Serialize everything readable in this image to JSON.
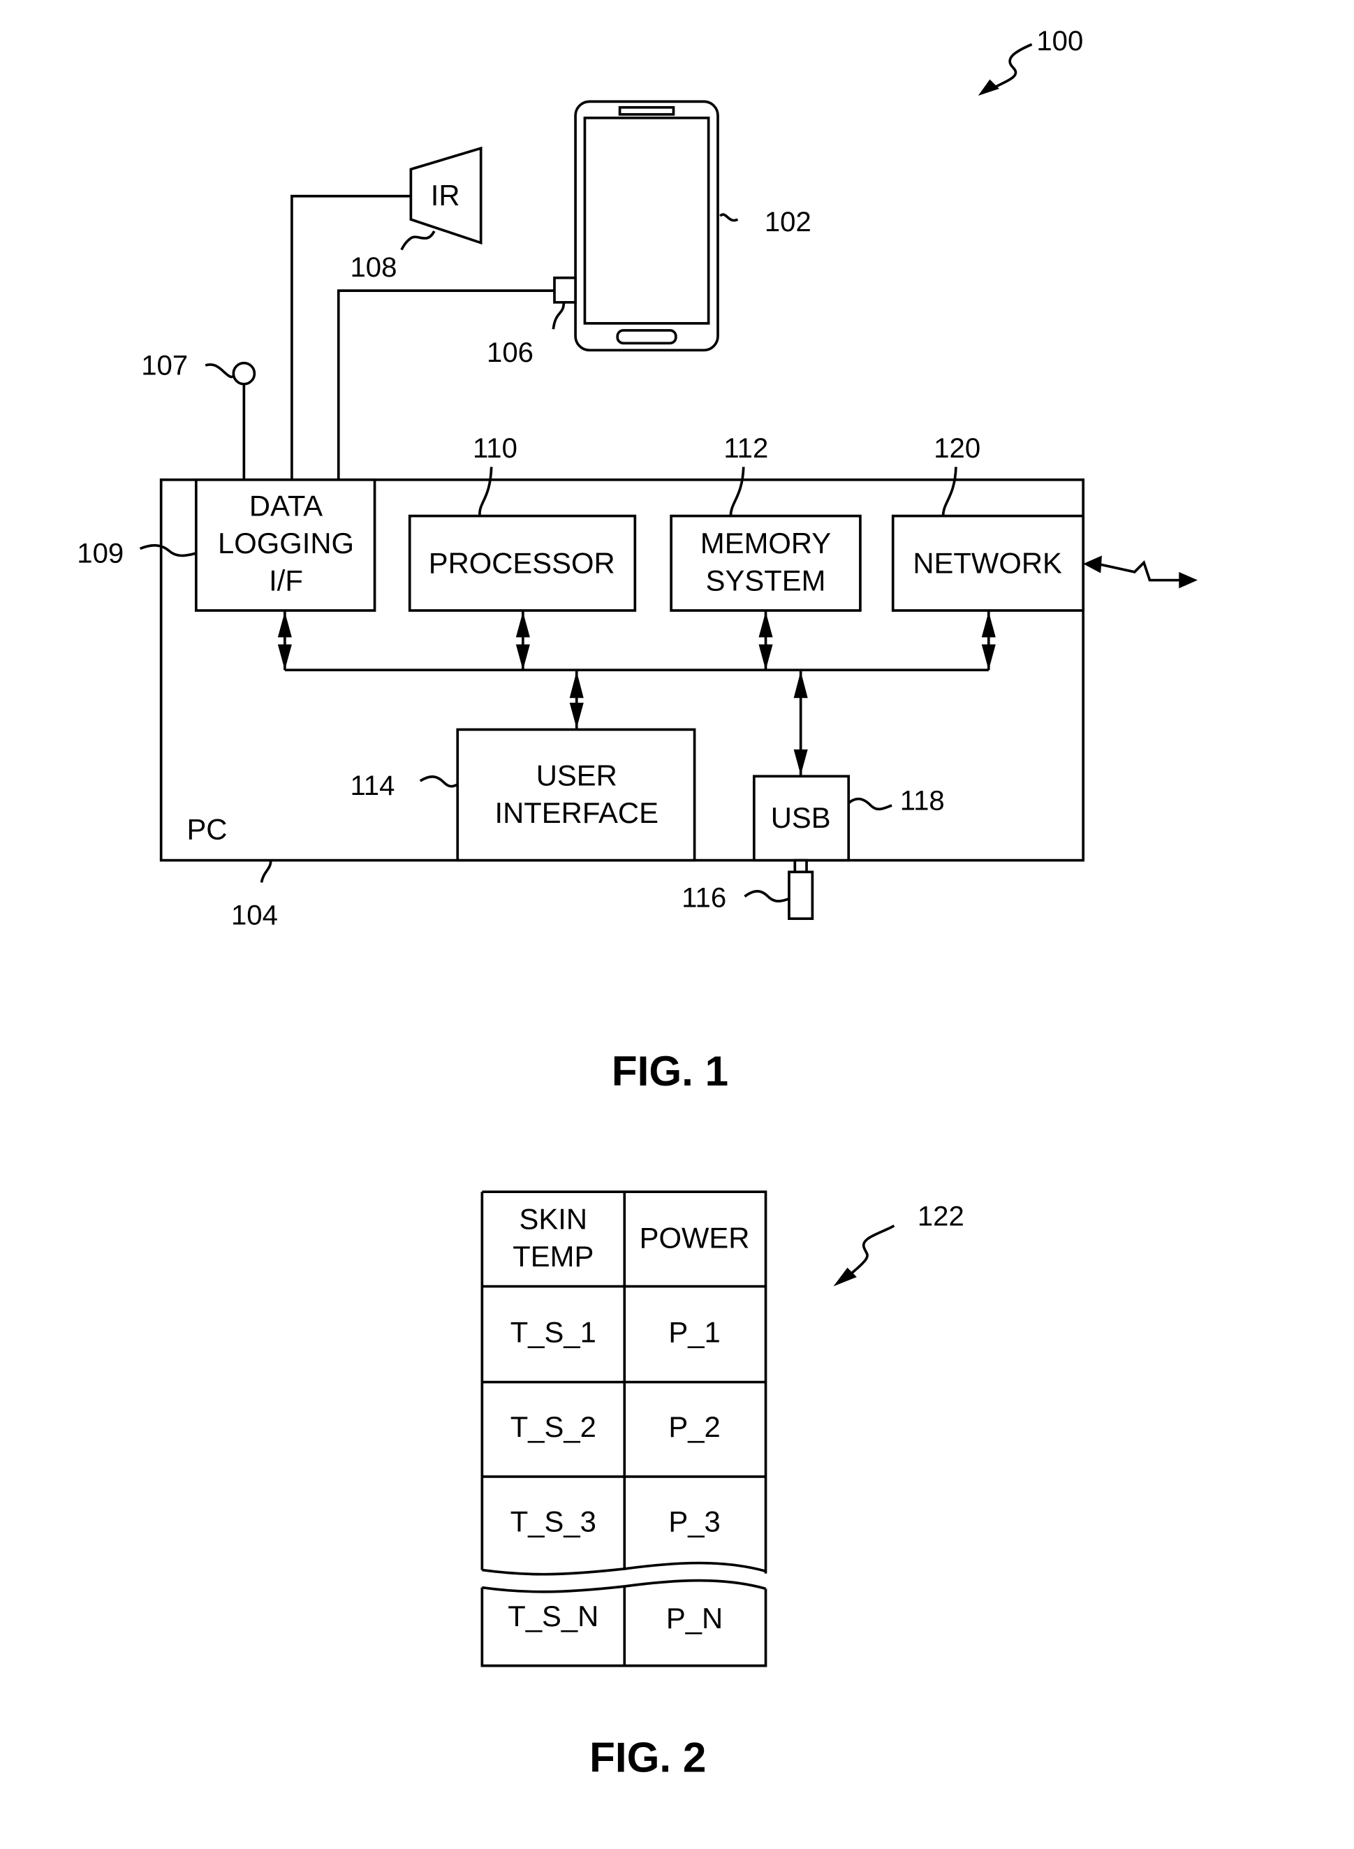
{
  "fig1": {
    "title": "FIG. 1",
    "ref_system": "100",
    "phone": {
      "ref": "102"
    },
    "connector": {
      "ref": "106"
    },
    "sensor": {
      "ref": "107"
    },
    "ir_sensor": {
      "label": "IR",
      "ref": "108"
    },
    "pc": {
      "label": "PC",
      "ref": "104"
    },
    "data_logging": {
      "line1": "DATA",
      "line2": "LOGGING",
      "line3": "I/F",
      "ref": "109"
    },
    "processor": {
      "label": "PROCESSOR",
      "ref": "110"
    },
    "memory": {
      "line1": "MEMORY",
      "line2": "SYSTEM",
      "ref": "112"
    },
    "network": {
      "label": "NETWORK",
      "ref": "120"
    },
    "user_interface": {
      "line1": "USER",
      "line2": "INTERFACE",
      "ref": "114"
    },
    "usb": {
      "label": "USB",
      "ref": "118"
    },
    "usb_stick": {
      "ref": "116"
    }
  },
  "fig2": {
    "title": "FIG. 2",
    "ref": "122",
    "headers": [
      [
        "SKIN",
        "TEMP"
      ],
      [
        "POWER"
      ]
    ],
    "rows": [
      [
        "T_S_1",
        "P_1"
      ],
      [
        "T_S_2",
        "P_2"
      ],
      [
        "T_S_3",
        "P_3"
      ],
      [
        "T_S_N",
        "P_N"
      ]
    ]
  }
}
